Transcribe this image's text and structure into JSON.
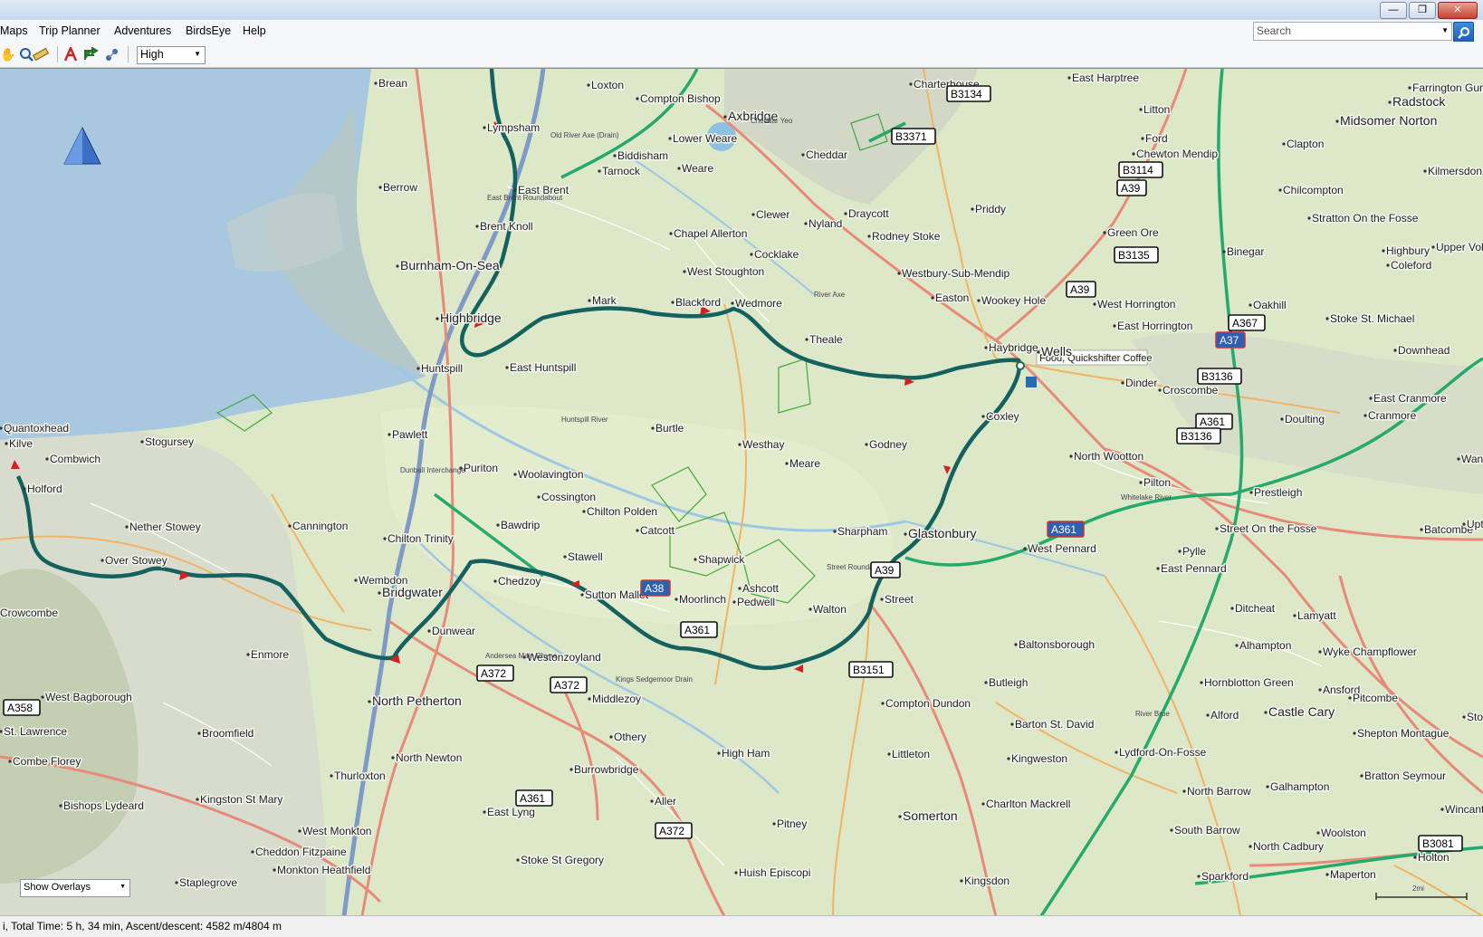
{
  "window": {
    "buttons": {
      "minimize": "—",
      "restore": "❐",
      "close": "✕"
    }
  },
  "menu": {
    "items": [
      "Maps",
      "Trip Planner",
      "Adventures",
      "BirdsEye",
      "Help"
    ]
  },
  "search": {
    "placeholder": "Search"
  },
  "toolbar": {
    "icons": [
      "hand-icon",
      "zoom-icon",
      "measure-icon",
      "route-icon",
      "directions-icon",
      "track-icon"
    ],
    "detail": "High"
  },
  "map": {
    "colors": {
      "sea": "#a9c9e0",
      "land": "#dde9cc",
      "route": "#1a6a6a",
      "a_road": "#e88a7a",
      "b_road": "#f2b66a",
      "motorway_green": "#26a96c",
      "water": "#8ec0df",
      "route_arrow": "#d22020"
    },
    "poi_label": "Food, Quickshifter Coffee",
    "places": [
      {
        "name": "Brean"
      },
      {
        "name": "Loxton"
      },
      {
        "name": "Compton Bishop"
      },
      {
        "name": "Charterhouse"
      },
      {
        "name": "East Harptree"
      },
      {
        "name": "Farrington Gurney"
      },
      {
        "name": "Lympsham"
      },
      {
        "name": "Axbridge"
      },
      {
        "name": "Cheddar"
      },
      {
        "name": "Litton"
      },
      {
        "name": "Radstock"
      },
      {
        "name": "Midsomer Norton"
      },
      {
        "name": "Lower Weare"
      },
      {
        "name": "Ford"
      },
      {
        "name": "Chewton Mendip"
      },
      {
        "name": "Clapton"
      },
      {
        "name": "Biddisham"
      },
      {
        "name": "Tarnock"
      },
      {
        "name": "Weare"
      },
      {
        "name": "Kilmersdon"
      },
      {
        "name": "Berrow"
      },
      {
        "name": "East Brent"
      },
      {
        "name": "Draycott"
      },
      {
        "name": "Priddy"
      },
      {
        "name": "Chilcompton"
      },
      {
        "name": "Clewer"
      },
      {
        "name": "Nyland"
      },
      {
        "name": "Stratton On the Fosse"
      },
      {
        "name": "Brent Knoll"
      },
      {
        "name": "Chapel Allerton"
      },
      {
        "name": "Rodney Stoke"
      },
      {
        "name": "Green Ore"
      },
      {
        "name": "Binegar"
      },
      {
        "name": "Highbury"
      },
      {
        "name": "Upper Vob"
      },
      {
        "name": "Coleford"
      },
      {
        "name": "Cocklake"
      },
      {
        "name": "Burnham-On-Sea"
      },
      {
        "name": "West Stoughton"
      },
      {
        "name": "Westbury-Sub-Mendip"
      },
      {
        "name": "Mark"
      },
      {
        "name": "Blackford"
      },
      {
        "name": "Wedmore"
      },
      {
        "name": "Easton"
      },
      {
        "name": "Wookey Hole"
      },
      {
        "name": "West Horrington"
      },
      {
        "name": "Oakhill"
      },
      {
        "name": "Highbridge"
      },
      {
        "name": "East Horrington"
      },
      {
        "name": "Stoke St. Michael"
      },
      {
        "name": "Theale"
      },
      {
        "name": "Haybridge"
      },
      {
        "name": "Wells"
      },
      {
        "name": "Downhead"
      },
      {
        "name": "Huntspill"
      },
      {
        "name": "East Huntspill"
      },
      {
        "name": "Dinder"
      },
      {
        "name": "Croscombe"
      },
      {
        "name": "East Cranmore"
      },
      {
        "name": "Quantoxhead"
      },
      {
        "name": "Coxley"
      },
      {
        "name": "Doulting"
      },
      {
        "name": "Cranmore"
      },
      {
        "name": "Burtle"
      },
      {
        "name": "Kilve"
      },
      {
        "name": "Stogursey"
      },
      {
        "name": "Pawlett"
      },
      {
        "name": "Westhay"
      },
      {
        "name": "Godney"
      },
      {
        "name": "Combwich"
      },
      {
        "name": "North Wootton"
      },
      {
        "name": "Wanst"
      },
      {
        "name": "Meare"
      },
      {
        "name": "Puriton"
      },
      {
        "name": "Pilton"
      },
      {
        "name": "Holford"
      },
      {
        "name": "Woolavington"
      },
      {
        "name": "Prestleigh"
      },
      {
        "name": "Cossington"
      },
      {
        "name": "Chilton Polden"
      },
      {
        "name": "Nether Stowey"
      },
      {
        "name": "Cannington"
      },
      {
        "name": "Catcott"
      },
      {
        "name": "Street On the Fosse"
      },
      {
        "name": "Batcombe"
      },
      {
        "name": "Upton"
      },
      {
        "name": "Sharpham"
      },
      {
        "name": "Glastonbury"
      },
      {
        "name": "Chilton Trinity"
      },
      {
        "name": "Bawdrip"
      },
      {
        "name": "West Pennard"
      },
      {
        "name": "Pylle"
      },
      {
        "name": "Over Stowey"
      },
      {
        "name": "Stawell"
      },
      {
        "name": "Shapwick"
      },
      {
        "name": "East Pennard"
      },
      {
        "name": "Wembdon"
      },
      {
        "name": "Chedzoy"
      },
      {
        "name": "Ashcott"
      },
      {
        "name": "Sutton Mallet"
      },
      {
        "name": "Bridgwater"
      },
      {
        "name": "Moorlinch"
      },
      {
        "name": "Pedwell"
      },
      {
        "name": "Walton"
      },
      {
        "name": "Street"
      },
      {
        "name": "Ditcheat"
      },
      {
        "name": "Lamyatt"
      },
      {
        "name": "Crowcombe"
      },
      {
        "name": "Dunwear"
      },
      {
        "name": "Alhampton"
      },
      {
        "name": "Baltonsborough"
      },
      {
        "name": "Enmore"
      },
      {
        "name": "Westonzoyland"
      },
      {
        "name": "Wyke Champflower"
      },
      {
        "name": "Butleigh"
      },
      {
        "name": "Hornblotton Green"
      },
      {
        "name": "West Bagborough"
      },
      {
        "name": "Ansford"
      },
      {
        "name": "North Petherton"
      },
      {
        "name": "Middlezoy"
      },
      {
        "name": "Compton Dundon"
      },
      {
        "name": "Pitcombe"
      },
      {
        "name": "Castle Cary"
      },
      {
        "name": "Stoney"
      },
      {
        "name": "Alford"
      },
      {
        "name": "Barton St. David"
      },
      {
        "name": "St. Lawrence"
      },
      {
        "name": "Broomfield"
      },
      {
        "name": "Othery"
      },
      {
        "name": "Shepton Montague"
      },
      {
        "name": "Lydford-On-Fosse"
      },
      {
        "name": "Combe Florey"
      },
      {
        "name": "North Newton"
      },
      {
        "name": "High Ham"
      },
      {
        "name": "Littleton"
      },
      {
        "name": "Kingweston"
      },
      {
        "name": "Burrowbridge"
      },
      {
        "name": "Thurloxton"
      },
      {
        "name": "Bratton Seymour"
      },
      {
        "name": "North Barrow"
      },
      {
        "name": "Galhampton"
      },
      {
        "name": "Kingston St Mary"
      },
      {
        "name": "Aller"
      },
      {
        "name": "Charlton Mackrell"
      },
      {
        "name": "Bishops Lydeard"
      },
      {
        "name": "East Lyng"
      },
      {
        "name": "Wincanton"
      },
      {
        "name": "Somerton"
      },
      {
        "name": "West Monkton"
      },
      {
        "name": "Pitney"
      },
      {
        "name": "South Barrow"
      },
      {
        "name": "Woolston"
      },
      {
        "name": "Cheddon Fitzpaine"
      },
      {
        "name": "North Cadbury"
      },
      {
        "name": "Stoke St Gregory"
      },
      {
        "name": "Holton"
      },
      {
        "name": "Monkton Heathfield"
      },
      {
        "name": "Huish Episcopi"
      },
      {
        "name": "Staplegrove"
      },
      {
        "name": "Kingsdon"
      },
      {
        "name": "Sparkford"
      },
      {
        "name": "Maperton"
      }
    ],
    "road_shields": [
      "B3134",
      "B3371",
      "B3114",
      "A39",
      "B3135",
      "A39",
      "A367",
      "A37",
      "B3136",
      "A361",
      "B3136",
      "A39",
      "A361",
      "A38",
      "A361",
      "B3151",
      "A372",
      "A372",
      "A361",
      "A372",
      "A358",
      "B3081"
    ],
    "small_labels": [
      "East Brent Roundabout",
      "Dunball Interchange",
      "Street Roundabout",
      "Old River Axe (Drain)",
      "River Axe",
      "Cheddar Yeo",
      "Huntspill River",
      "Whitelake River",
      "River Brue",
      "Kings Sedgemoor Drain",
      "Andersea Main Rhyne"
    ],
    "scale": "2mi"
  },
  "overlay_select": {
    "value": "Show Overlays"
  },
  "status": {
    "text": "i, Total Time: 5 h, 34 min, Ascent/descent: 4582 m/4804 m"
  }
}
